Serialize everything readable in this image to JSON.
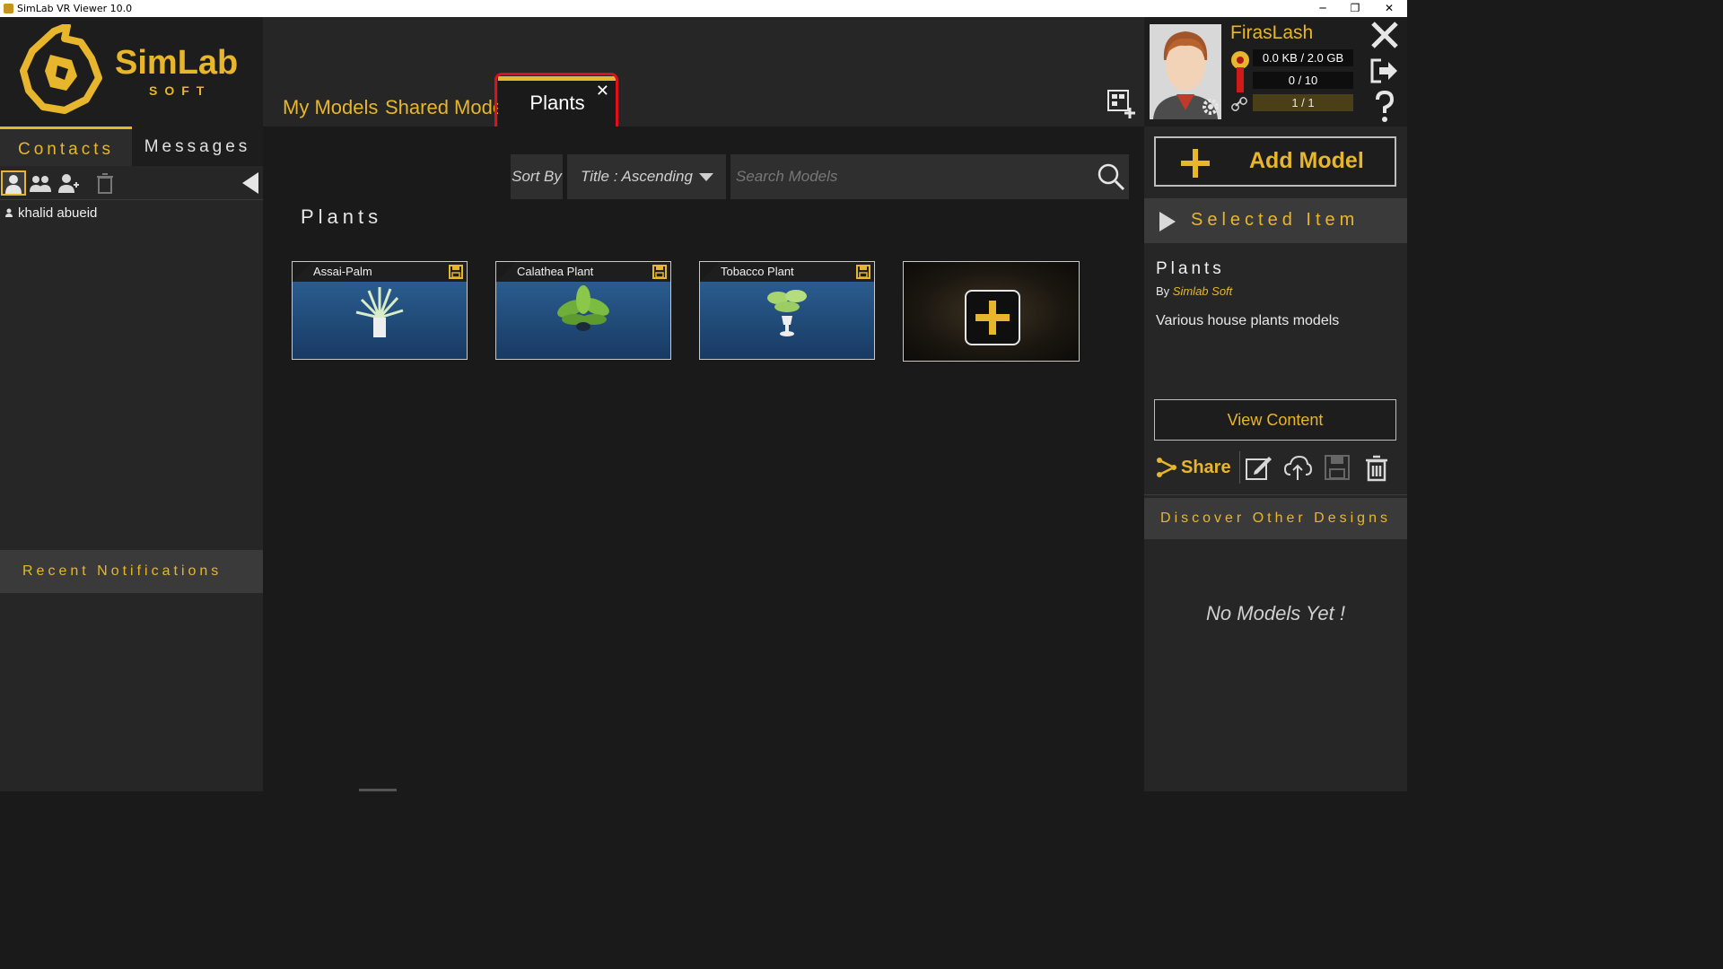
{
  "window": {
    "title": "SimLab VR Viewer 10.0",
    "minimize": "─",
    "restore": "❐",
    "close": "✕"
  },
  "logo": {
    "name": "SimLab",
    "sub": "SOFT"
  },
  "contacts": {
    "tabs": [
      "Contacts",
      "Messages"
    ],
    "items": [
      "khalid abueid"
    ],
    "notifications_header": "Recent Notifications"
  },
  "tabs": [
    {
      "label": "My Models"
    },
    {
      "label": "Shared Models"
    },
    {
      "label": "Plants",
      "close": "✕"
    }
  ],
  "toolbar": {
    "sort_label": "Sort By",
    "sort_value": "Title : Ascending",
    "search_placeholder": "Search Models"
  },
  "section_title": "Plants",
  "models": [
    {
      "title": "Assai-Palm"
    },
    {
      "title": "Calathea Plant"
    },
    {
      "title": "Tobacco Plant"
    }
  ],
  "user": {
    "name": "FirasLash",
    "storage": "0.0 KB / 2.0 GB",
    "models": "0 / 10",
    "links": "1 / 1"
  },
  "right": {
    "add_model": "Add Model",
    "selected_header": "Selected Item",
    "selected_title": "Plants",
    "by_label": "By",
    "author": "Simlab Soft",
    "description": "Various house plants models",
    "view_content": "View Content",
    "share": "Share",
    "discover_header": "Discover Other Designs",
    "no_models": "No Models Yet !"
  },
  "colors": {
    "accent": "#e8b62c",
    "highlight": "#e0101a",
    "background": "#1a1a1a"
  }
}
